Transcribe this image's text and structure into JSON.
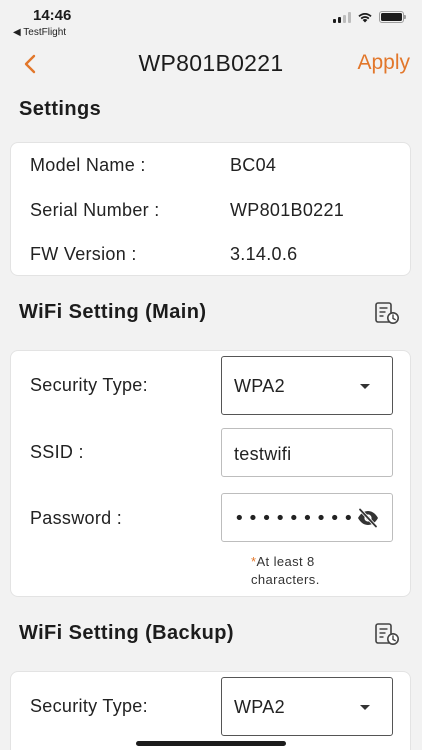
{
  "status_bar": {
    "time": "14:46",
    "back_app": "◀ TestFlight"
  },
  "nav": {
    "title": "WP801B0221",
    "apply_label": "Apply"
  },
  "settings": {
    "title": "Settings",
    "rows": [
      {
        "label": "Model Name :",
        "value": "BC04"
      },
      {
        "label": "Serial Number :",
        "value": "WP801B0221"
      },
      {
        "label": "FW Version :",
        "value": "3.14.0.6"
      }
    ]
  },
  "wifi_main": {
    "title": "WiFi Setting (Main)",
    "security_label": "Security Type:",
    "security_value": "WPA2",
    "ssid_label": "SSID :",
    "ssid_value": "testwifi",
    "password_label": "Password  :",
    "password_value": "•••••••••",
    "hint_star": "*",
    "hint_line1": "At least 8",
    "hint_line2": "characters."
  },
  "wifi_backup": {
    "title": "WiFi Setting (Backup)",
    "security_label": "Security Type:",
    "security_value": "WPA2"
  },
  "colors": {
    "accent": "#e2772b",
    "background": "#f2f2f2",
    "card": "#ffffff"
  },
  "icons": {
    "back": "chevron-left-icon",
    "history": "history-list-icon",
    "eye": "eye-off-icon"
  }
}
